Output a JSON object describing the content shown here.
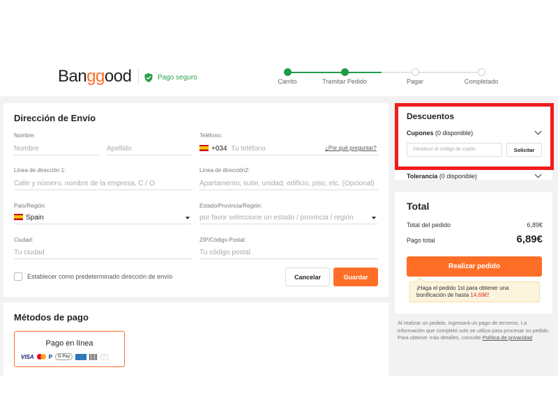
{
  "header": {
    "logo_prefix": "Ban",
    "logo_mid": "gg",
    "logo_suffix": "ood",
    "secure_label": "Pago seguro",
    "steps": [
      {
        "label": "Carrito",
        "state": "done"
      },
      {
        "label": "Tramitar Pedido",
        "state": "done"
      },
      {
        "label": "Pagar",
        "state": "todo"
      },
      {
        "label": "Completado",
        "state": "todo"
      }
    ]
  },
  "shipping": {
    "title": "Dirección de Envío",
    "name_label": "Nombre:",
    "name_placeholder": "Nombre",
    "surname_placeholder": "Apellido",
    "phone_label": "Teléfono:",
    "phone_prefix": "+034",
    "phone_placeholder": "Tu teléfono",
    "why_ask": "¿Por qué preguntar?",
    "addr1_label": "Línea de dirección 1:",
    "addr1_placeholder": "Calle y número, nombre de la empresa, C / O",
    "addr2_label": "Línea de dirección2:",
    "addr2_placeholder": "Apartamento, suite, unidad, edificio, piso, etc. (Opcional)",
    "country_label": "País/Región:",
    "country_value": "Spain",
    "state_label": "Estado/Provincia/Región:",
    "state_placeholder": "por favor seleccione un estado / provincia / región",
    "city_label": "Ciudad:",
    "city_placeholder": "Tu ciudad",
    "zip_label": "ZIP/Código Postal:",
    "zip_placeholder": "Tu código postal",
    "default_checkbox": "Establecer como predeterminado dirección de envío",
    "cancel": "Cancelar",
    "save": "Guardar"
  },
  "payment": {
    "title": "Métodos de pago",
    "option": "Pago en línea",
    "icons": [
      "visa-icon",
      "mastercard-icon",
      "paypal-icon",
      "gpay-icon",
      "amex-icon",
      "boleto-icon",
      "more-icon"
    ],
    "visa_text": "VISA",
    "paypal_text": "P",
    "gpay_text": "G Pay",
    "more_text": "···"
  },
  "discounts": {
    "title": "Descuentos",
    "coupons_label": "Cupones",
    "coupons_count": "(0 disponible)",
    "coupon_placeholder": "Introduce el código de cupón",
    "request": "Solicitar",
    "tolerance_label": "Tolerancia",
    "tolerance_count": "(0 disponible)"
  },
  "total": {
    "title": "Total",
    "subtotal_label": "Total del pedido",
    "subtotal_value": "6,89€",
    "pay_label": "Pago total",
    "pay_value": "6,89€",
    "order_button": "Realizar pedido",
    "promo_text": "¡Haga el pedido 1st para obtener una bonificación de hasta ",
    "promo_amount": "14,69€",
    "promo_end": "!"
  },
  "note": {
    "text": "Al realizar un pedido, ingresará un pago de terceros. La información que completó solo se utiliza para procesar su pedido. Para obtener más detalles, consulte ",
    "link": "Política de privacidad"
  },
  "colors": {
    "accent": "#ff6e26",
    "progress": "#1f9b4a",
    "highlight": "#f01d1d",
    "secure": "#2aa14a"
  }
}
